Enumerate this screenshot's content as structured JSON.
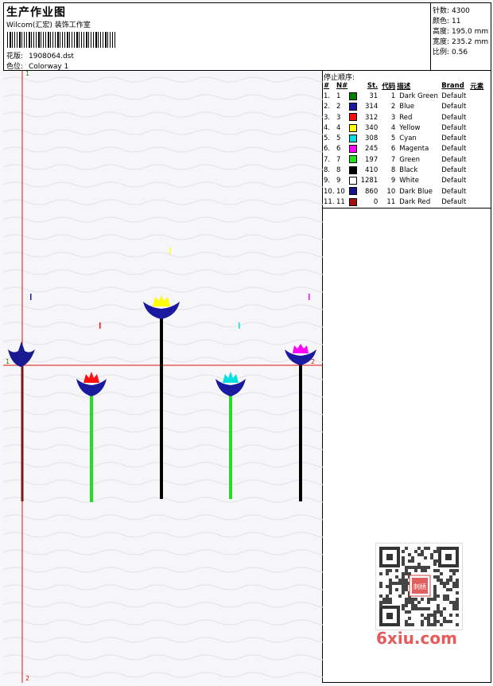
{
  "header": {
    "title": "生产作业图",
    "studio": "Wilcom(汇宏) 装饰工作室",
    "design_label": "花版:",
    "design_value": "1908064.dst",
    "color_label": "色位:",
    "color_value": "Colorway 1"
  },
  "stats": [
    {
      "label": "针数:",
      "value": "4300"
    },
    {
      "label": "颜色:",
      "value": "11"
    },
    {
      "label": "高度:",
      "value": "195.0 mm"
    },
    {
      "label": "宽度:",
      "value": "235.2 mm"
    },
    {
      "label": "比例:",
      "value": "0.56"
    }
  ],
  "stop_sequence": {
    "title": "停止顺序:",
    "headers": [
      "#",
      "N#",
      "St.",
      "代码",
      "描述",
      "Brand",
      "元素"
    ],
    "rows": [
      {
        "idx": "1.",
        "n": "1",
        "st": "31",
        "code": "1",
        "desc": "Dark Green",
        "brand": "Default",
        "color": "#008000"
      },
      {
        "idx": "2.",
        "n": "2",
        "st": "314",
        "code": "2",
        "desc": "Blue",
        "brand": "Default",
        "color": "#1a1aa0"
      },
      {
        "idx": "3.",
        "n": "3",
        "st": "312",
        "code": "3",
        "desc": "Red",
        "brand": "Default",
        "color": "#ff1010"
      },
      {
        "idx": "4.",
        "n": "4",
        "st": "340",
        "code": "4",
        "desc": "Yellow",
        "brand": "Default",
        "color": "#ffff00"
      },
      {
        "idx": "5.",
        "n": "5",
        "st": "308",
        "code": "5",
        "desc": "Cyan",
        "brand": "Default",
        "color": "#00e0e0"
      },
      {
        "idx": "6.",
        "n": "6",
        "st": "245",
        "code": "6",
        "desc": "Magenta",
        "brand": "Default",
        "color": "#ff00ff"
      },
      {
        "idx": "7.",
        "n": "7",
        "st": "197",
        "code": "7",
        "desc": "Green",
        "brand": "Default",
        "color": "#20e020"
      },
      {
        "idx": "8.",
        "n": "8",
        "st": "410",
        "code": "8",
        "desc": "Black",
        "brand": "Default",
        "color": "#000000"
      },
      {
        "idx": "9.",
        "n": "9",
        "st": "1281",
        "code": "9",
        "desc": "White",
        "brand": "Default",
        "color": "#ffffff"
      },
      {
        "idx": "10.",
        "n": "10",
        "st": "860",
        "code": "10",
        "desc": "Dark Blue",
        "brand": "Default",
        "color": "#14148c"
      },
      {
        "idx": "11.",
        "n": "11",
        "st": "0",
        "code": "11",
        "desc": "Dark Red",
        "brand": "Default",
        "color": "#a01010"
      }
    ]
  },
  "axis_markers": {
    "top": "1",
    "left": "1",
    "right": "2",
    "bottom": "2"
  },
  "watermark": {
    "text": "6xiu.com",
    "seal": "刺绣"
  }
}
